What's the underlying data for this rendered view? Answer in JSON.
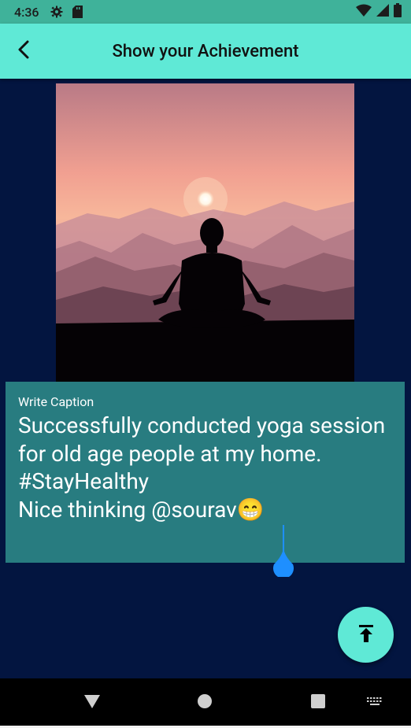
{
  "status_bar": {
    "time": "4:36"
  },
  "app_bar": {
    "title": "Show your Achievement"
  },
  "caption": {
    "label": "Write Caption",
    "text": "Successfully conducted yoga session for old age people at my home.\n#StayHealthy\nNice thinking @sourav😁"
  },
  "icons": {
    "status": [
      "gear-icon",
      "sd-card-icon",
      "wifi-icon",
      "cellular-signal-icon",
      "battery-icon"
    ],
    "back": "arrow-left-icon",
    "fab": "upload-icon",
    "nav": [
      "back-triangle-icon",
      "home-circle-icon",
      "recents-square-icon",
      "keyboard-icon"
    ]
  },
  "colors": {
    "status_bar": "#3fb29a",
    "app_bar": "#5fe9d6",
    "background": "#031540",
    "caption_card": "#287c80",
    "fab": "#5fe9d6",
    "cursor": "#1e8fff"
  }
}
